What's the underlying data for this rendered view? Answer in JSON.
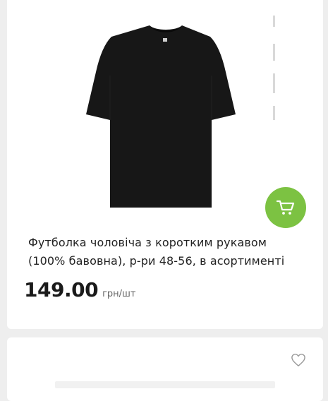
{
  "product": {
    "title": "Футболка чоловіча з коротким рукавом (100% бавовна), р-ри 48-56, в асортименті",
    "price": "149.00",
    "unit": "грн/шт",
    "image_alt": "Чорна футболка",
    "actions": {
      "cart_icon": "shopping-cart-icon"
    }
  },
  "next_product": {
    "actions": {
      "favorite_icon": "heart-icon"
    }
  },
  "colors": {
    "page_background": "#eeeeee",
    "card_background": "#ffffff",
    "accent_green": "#7cc242",
    "text_dark": "#222222",
    "text_muted": "#666666",
    "shirt": "#171717"
  }
}
